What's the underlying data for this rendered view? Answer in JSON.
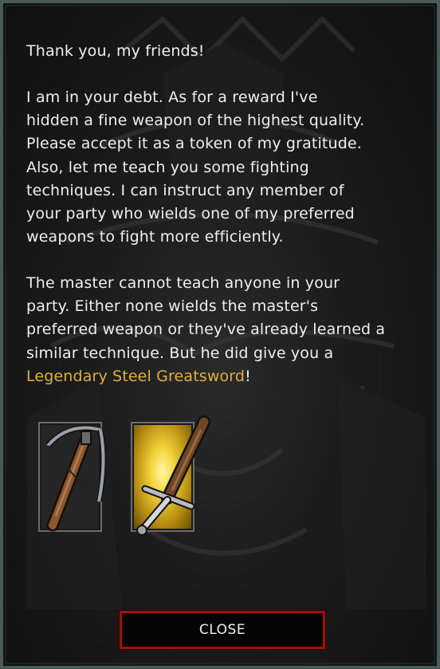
{
  "dialog": {
    "greeting": "Thank you, my friends!",
    "paragraph1_lines": [
      "I am in your debt. As for a reward  I've",
      "hidden a fine weapon of the highest quality.",
      "Please accept it as a token of my gratitude.",
      "Also, let me teach you some fighting",
      "techniques. I can instruct any member of",
      "your party who wields one of my preferred",
      "weapons to fight more efficiently."
    ],
    "paragraph2_lines": [
      "The master cannot teach anyone in your",
      "party. Either none wields the master's",
      "preferred weapon or they've already learned a",
      "similar technique. But he did give you a"
    ],
    "reward_name": "Legendary Steel Greatsword",
    "reward_suffix": "!",
    "reward_color": "#e0b040"
  },
  "items": [
    {
      "icon": "crossbow-icon",
      "highlighted": false
    },
    {
      "icon": "greatsword-icon",
      "highlighted": true
    }
  ],
  "close_button": {
    "label": "CLOSE",
    "border_color": "#9b1111"
  }
}
